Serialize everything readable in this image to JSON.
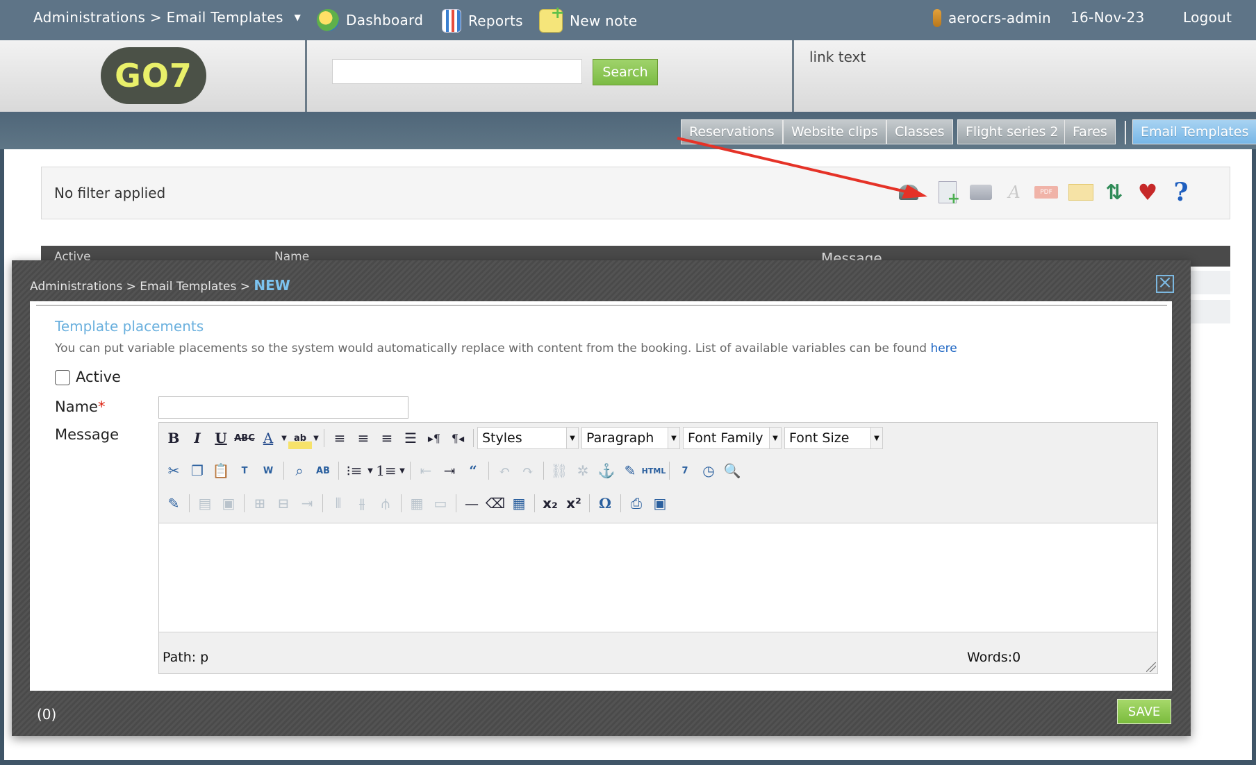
{
  "nav": {
    "admin_menu": "Administrations > Email Templates",
    "dashboard": "Dashboard",
    "reports": "Reports",
    "new_note": "New note",
    "user": "aerocrs-admin",
    "date": "16-Nov-23",
    "logout": "Logout"
  },
  "header": {
    "logo": "GO7",
    "search_value": "",
    "search_button": "Search",
    "link_text": "link text"
  },
  "tabs": [
    "Reservations",
    "Website clips",
    "Classes",
    "Flight series 2",
    "Fares",
    "Email Templates"
  ],
  "active_tab": "Email Templates",
  "filter": {
    "text": "No filter applied"
  },
  "toolbar_icons": [
    "user-search-icon",
    "new-document-icon",
    "print-icon",
    "text-icon",
    "pdf-icon",
    "email-icon",
    "refresh-icon",
    "favorite-icon",
    "help-icon"
  ],
  "grid": {
    "columns": [
      "Active",
      "Name",
      "Message"
    ]
  },
  "modal": {
    "breadcrumb": "Administrations > Email Templates > ",
    "breadcrumb_current": "NEW",
    "section_title": "Template placements",
    "section_desc": "You can put variable placements so the system would automatically replace with content from the booking. List of available variables can be found ",
    "section_link": "here",
    "active_label": "Active",
    "active_checked": false,
    "name_label": "Name",
    "name_required_mark": "*",
    "name_value": "",
    "message_label": "Message",
    "editor": {
      "styles": "Styles",
      "paragraph": "Paragraph",
      "font_family": "Font Family",
      "font_size": "Font Size",
      "html_label": "HTML",
      "path": "Path: p",
      "words": "Words:0"
    },
    "count": "(0)",
    "save": "SAVE"
  },
  "colors": {
    "accent": "#7cc3f0",
    "save": "#8cc850",
    "nav": "#5e7487"
  }
}
